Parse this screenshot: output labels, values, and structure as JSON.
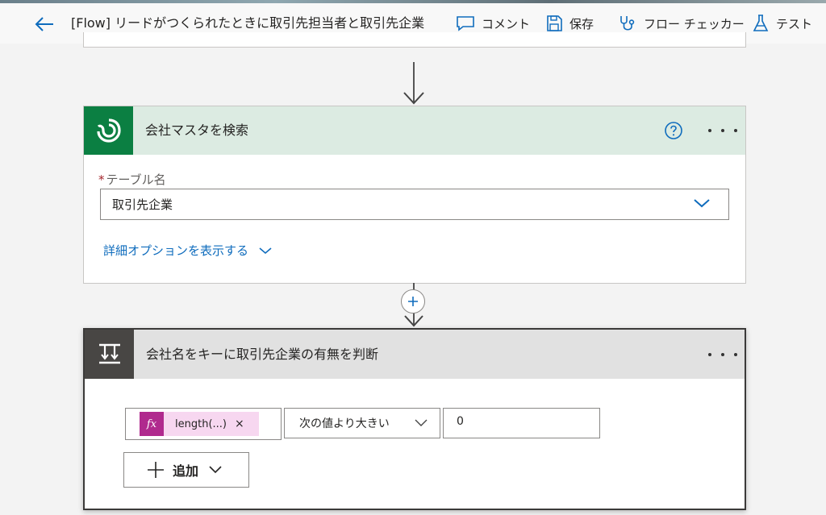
{
  "header": {
    "flow_title": "[Flow] リードがつくられたときに取引先担当者と取引先企業",
    "actions": {
      "comment": "コメント",
      "save": "保存",
      "flow_checker": "フロー チェッカー",
      "test": "テスト"
    }
  },
  "search_card": {
    "title": "会社マスタを検索",
    "table_label_required": "*",
    "table_label": "テーブル名",
    "table_value": "取引先企業",
    "advanced_options": "詳細オプションを表示する"
  },
  "condition_card": {
    "title": "会社名をキーに取引先企業の有無を判断",
    "token_icon": "fx",
    "token_label": "length(...)",
    "token_remove": "×",
    "operator": "次の値より大きい",
    "value": "0",
    "add_label": "追加"
  },
  "colors": {
    "dataverse_green": "#0b7f42",
    "header_green_tint": "#dcebe2",
    "condition_dark": "#484644",
    "fx_token_magenta": "#b02a8e",
    "link_blue": "#0f6cbd"
  }
}
